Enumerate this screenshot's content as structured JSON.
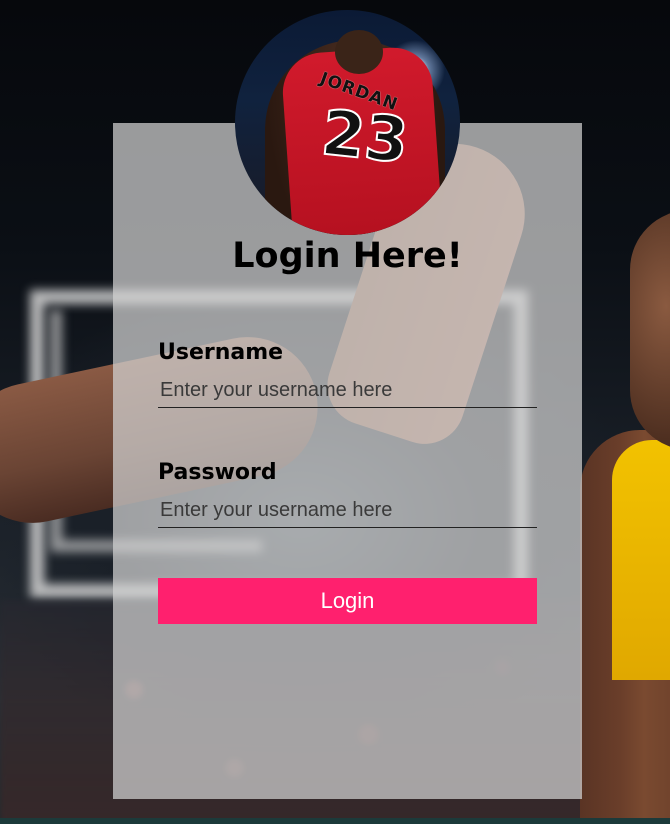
{
  "form": {
    "title": "Login Here!",
    "username": {
      "label": "Username",
      "placeholder": "Enter your username here",
      "value": ""
    },
    "password": {
      "label": "Password",
      "placeholder": "Enter your username here",
      "value": ""
    },
    "submit_label": "Login"
  },
  "avatar": {
    "jersey_name": "JORDAN",
    "jersey_number": "23"
  },
  "colors": {
    "button": "#ff206e",
    "panel": "rgba(210,210,210,0.72)"
  }
}
